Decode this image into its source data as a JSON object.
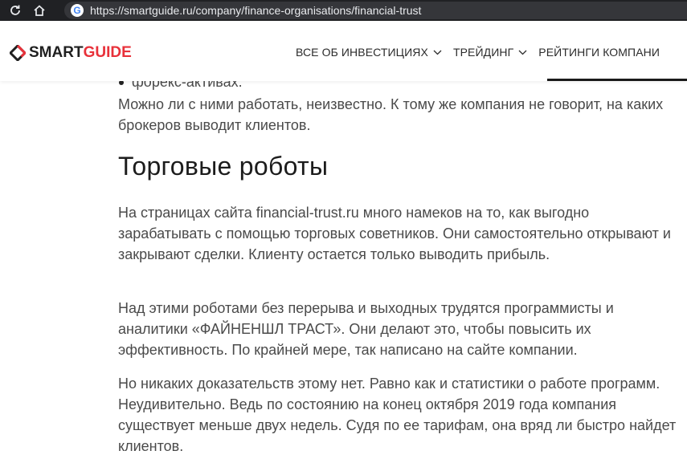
{
  "browser": {
    "url": "https://smartguide.ru/company/finance-organisations/financial-trust",
    "favicon_letter": "G",
    "icons": [
      "refresh-icon",
      "home-icon",
      "google-icon"
    ]
  },
  "header": {
    "logo": {
      "part1": "SMART",
      "part2": "GUIDE",
      "color_dark": "#1f1f1f",
      "color_accent": "#e8313a"
    },
    "nav": [
      {
        "label": "ВСЕ ОБ ИНВЕСТИЦИЯХ",
        "has_dropdown": true
      },
      {
        "label": "ТРЕЙДИНГ",
        "has_dropdown": true
      },
      {
        "label": "РЕЙТИНГИ КОМПАНИ",
        "has_dropdown": false
      }
    ]
  },
  "article": {
    "bullet_item": "форекс-активах.",
    "intro_paragraph": "Можно ли с ними работать, неизвестно. К тому же компания не говорит, на каких брокеров выводит клиентов.",
    "heading": "Торговые роботы",
    "paragraphs": [
      "На страницах сайта financial-trust.ru много намеков на то, как выгодно зарабатывать с помощью торговых советников. Они самостоятельно открывают и закрывают сделки. Клиенту остается только выводить прибыль.",
      "Над этими роботами без перерыва и выходных трудятся программисты и аналитики «ФАЙНЕНШЛ ТРАСТ». Они делают это, чтобы повысить их эффективность. По крайней мере, так написано на сайте компании.",
      "Но никаких доказательств этому нет. Равно как и статистики о работе программ. Неудивительно. Ведь по состоянию на конец октября 2019 года компания существует меньше двух недель. Судя по ее тарифам, она вряд ли быстро найдет клиентов."
    ]
  }
}
